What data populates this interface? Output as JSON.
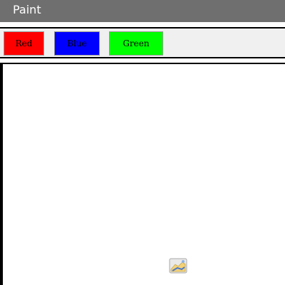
{
  "window": {
    "title": "Paint"
  },
  "toolbar": {
    "buttons": [
      {
        "label": "Red",
        "color": "#ff0000"
      },
      {
        "label": "Blue",
        "color": "#0000ff"
      },
      {
        "label": "Green",
        "color": "#00ff00"
      }
    ]
  },
  "colors": {
    "titlebar": "#6f6f6f",
    "toolbar_bg": "#f0f0f0",
    "canvas_bg": "#ffffff"
  },
  "canvas": {
    "icon": "paint-brush-cursor-icon"
  }
}
